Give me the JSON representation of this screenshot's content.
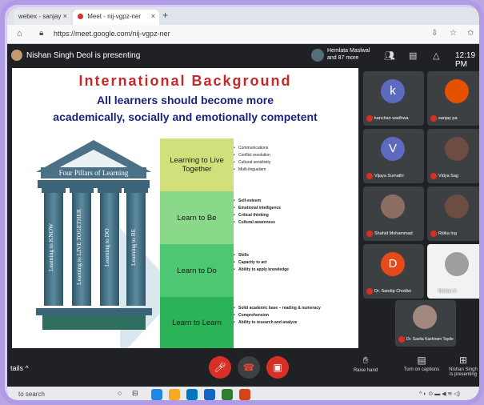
{
  "browser": {
    "tabs": [
      {
        "label": "webex - sanjay"
      },
      {
        "label": "Meet - nij-vgpz-ner"
      }
    ],
    "url": "https://meet.google.com/nij-vgpz-ner"
  },
  "meet": {
    "presenting_text": "Nishan Singh Deol is presenting",
    "participants_text_line1": "Hemlata Maslwal",
    "participants_text_line2": "and 87 more",
    "time": "12:19 PM"
  },
  "slide": {
    "title": "International Background",
    "subtitle_line1": "All learners should become more",
    "subtitle_line2": "academically, socially and emotionally competent",
    "temple_label": "Four Pillars of Learning",
    "pillars": [
      "Learning to KNOW",
      "Learning to LIVE TOGETHER",
      "Learning to DO",
      "Learning to BE"
    ],
    "boxes": [
      {
        "label": "Learning to Live Together",
        "bullets": [
          "Communications",
          "Conflict resolution",
          "Cultural sensitivity",
          "Multi-lingualism"
        ]
      },
      {
        "label": "Learn to Be",
        "bullets": [
          "Self-esteem",
          "Emotional intelligence",
          "Critical thinking",
          "Cultural awareness"
        ]
      },
      {
        "label": "Learn to Do",
        "bullets": [
          "Skills",
          "Capacity to act",
          "Ability to apply knowledge"
        ]
      },
      {
        "label": "Learn to Learn",
        "bullets": [
          "Solid academic base – reading & numeracy",
          "Comprehension",
          "Ability to research and analyze"
        ]
      }
    ]
  },
  "tiles": [
    {
      "initial": "k",
      "name": "kanchan wadhwa",
      "color": "#5c6bc0"
    },
    {
      "initial": "",
      "name": "sanjay pa",
      "color": "#e65100"
    },
    {
      "initial": "V",
      "name": "Vijaya Sumathi",
      "color": "#5c6bc0"
    },
    {
      "initial": "",
      "name": "Vidya Sag",
      "color": "#6d4c41"
    },
    {
      "initial": "",
      "name": "Shahid Mohammad",
      "color": "#8d6e63"
    },
    {
      "initial": "",
      "name": "Ritika Ing",
      "color": "#6d4c41"
    },
    {
      "initial": "D",
      "name": "Dr. Sandip Chodke",
      "color": "#e64a19"
    },
    {
      "initial": "",
      "name": "Nishan S",
      "color": "#9e9e9e"
    },
    {
      "initial": "",
      "name": "Dr. Savita Kashiram Tayde",
      "color": "#a1887f"
    }
  ],
  "controls": {
    "details": "tails",
    "raise_hand": "Raise hand",
    "captions": "Turn on captions",
    "presenting_line1": "Nishan Singh",
    "presenting_line2": "is presenting"
  },
  "taskbar": {
    "search_placeholder": "to search"
  }
}
